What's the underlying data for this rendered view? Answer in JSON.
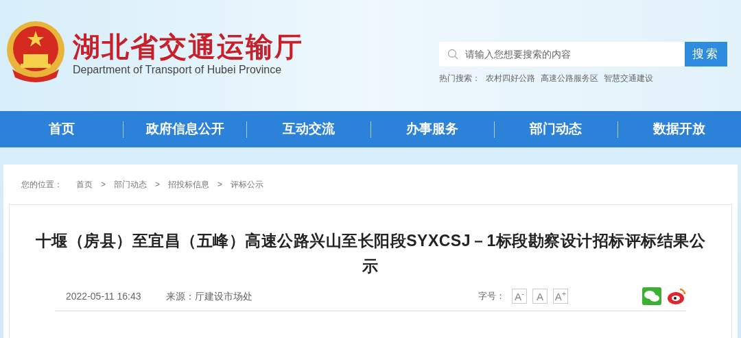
{
  "header": {
    "title": "湖北省交通运输厅",
    "subtitle": "Department of Transport of Hubei Province"
  },
  "search": {
    "placeholder": "请输入您想要搜索的内容",
    "button": "搜索",
    "hot_label": "热门搜索：",
    "hot_terms": [
      "农村四好公路",
      "高速公路服务区",
      "智慧交通建设"
    ]
  },
  "nav": [
    {
      "label": "首页",
      "selected": false
    },
    {
      "label": "政府信息公开",
      "selected": false
    },
    {
      "label": "互动交流",
      "selected": false
    },
    {
      "label": "办事服务",
      "selected": false
    },
    {
      "label": "部门动态",
      "selected": false
    },
    {
      "label": "数据开放",
      "selected": false
    }
  ],
  "breadcrumb": {
    "label": "您的位置：",
    "items": [
      "首页",
      "部门动态",
      "招投标信息",
      "评标公示"
    ],
    "separator": ">"
  },
  "article": {
    "title": "十堰（房县）至宜昌（五峰）高速公路兴山至长阳段SYXCSJ－1标段勘察设计招标评标结果公示",
    "date": "2022-05-11 16:43",
    "source_label": "来源：",
    "source": "厅建设市场处",
    "font_label": "字号：",
    "font_buttons": [
      "A$^{-}$",
      "A",
      "A$^{+}$"
    ]
  }
}
